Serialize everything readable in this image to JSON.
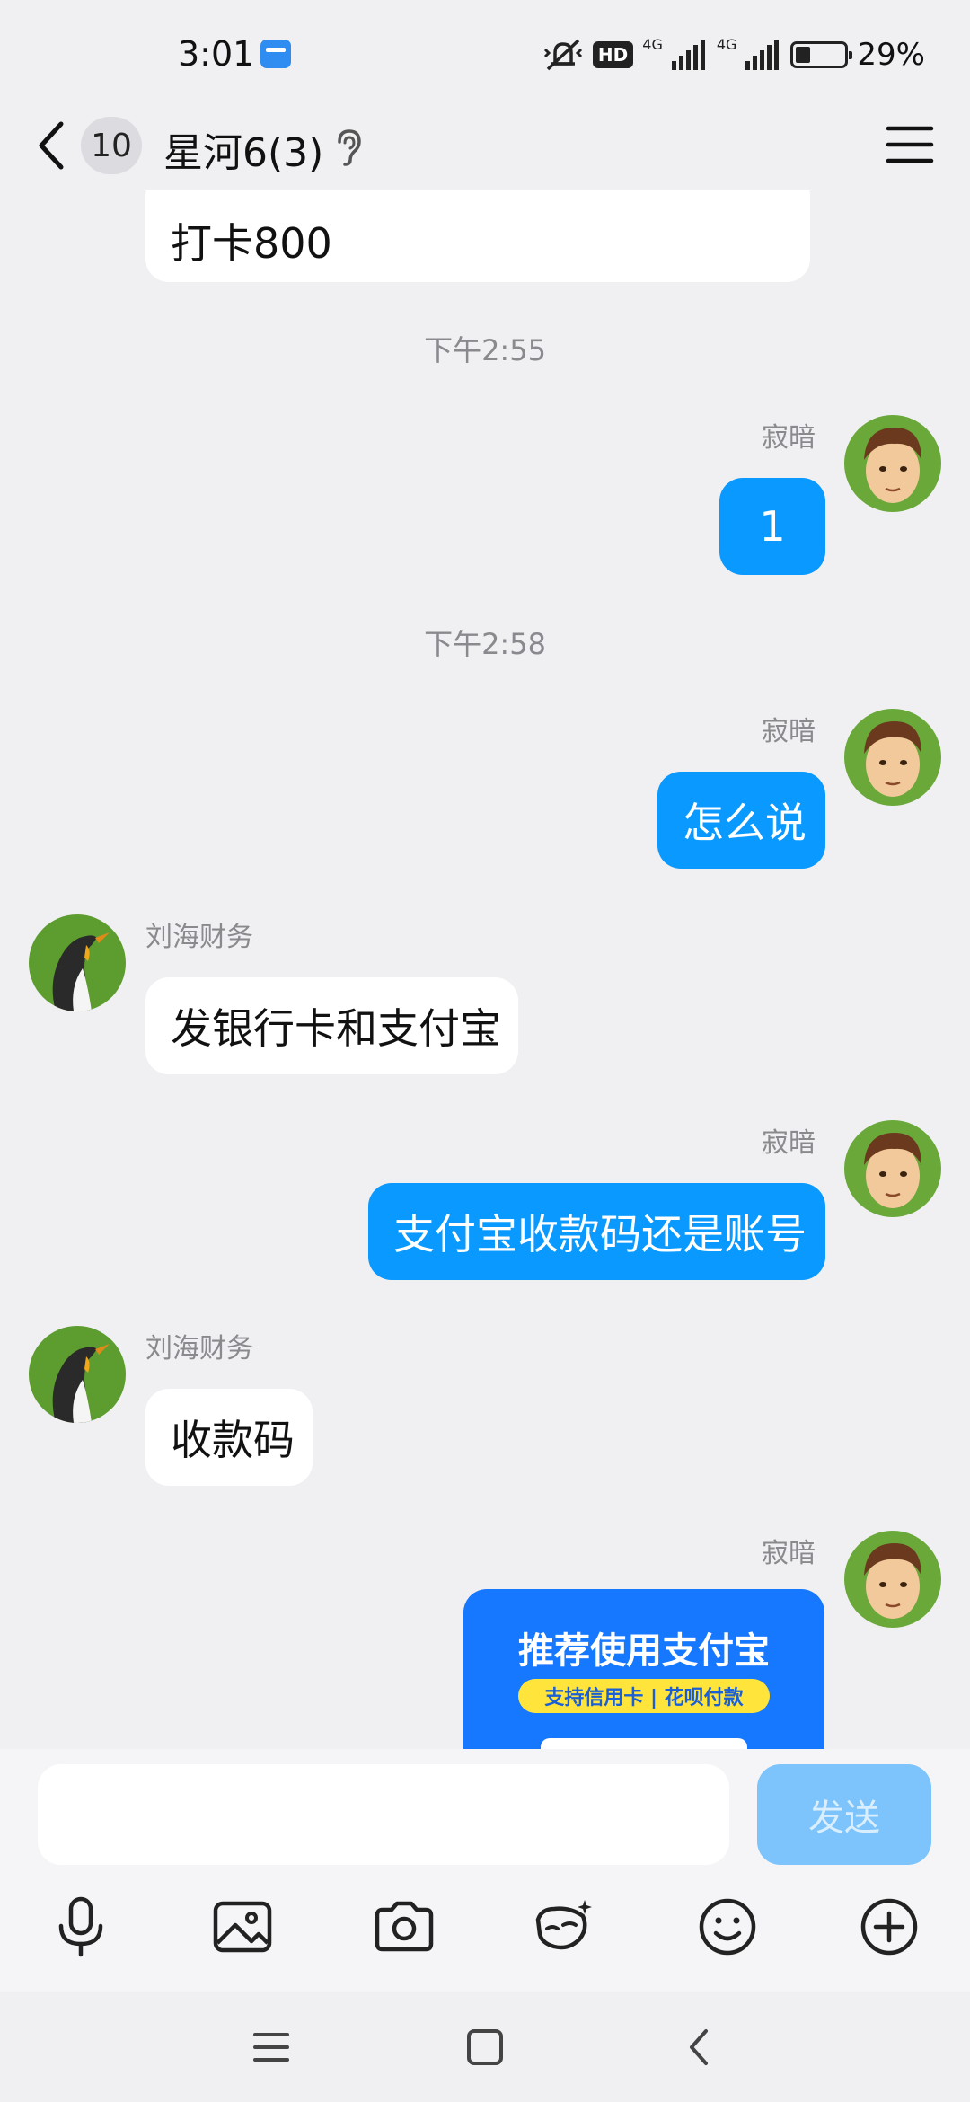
{
  "status_bar": {
    "time": "3:01",
    "network_label": "4G",
    "network_label_2": "4G",
    "hd_label": "HD",
    "battery_text": "29%"
  },
  "header": {
    "unread_count": "10",
    "title": "星河6(3)"
  },
  "messages": {
    "m1": {
      "text": "打卡800"
    },
    "ts1": "下午2:55",
    "m2": {
      "sender": "寂暗",
      "text": "1"
    },
    "ts2": "下午2:58",
    "m3": {
      "sender": "寂暗",
      "text": "怎么说"
    },
    "m4": {
      "sender": "刘海财务",
      "text": "发银行卡和支付宝"
    },
    "m5": {
      "sender": "寂暗",
      "text": "支付宝收款码还是账号"
    },
    "m6": {
      "sender": "刘海财务",
      "text": "收款码"
    },
    "m7": {
      "sender": "寂暗",
      "promo_title": "推荐使用支付宝",
      "promo_subtitle": "支持信用卡 | 花呗付款"
    }
  },
  "composer": {
    "input_value": "",
    "send_label": "发送"
  },
  "toolbar_icons": [
    "microphone-icon",
    "image-icon",
    "camera-icon",
    "ai-sparkle-icon",
    "emoji-icon",
    "plus-icon"
  ],
  "nav_icons": [
    "recents-icon",
    "home-icon",
    "back-icon"
  ],
  "colors": {
    "background": "#f0f0f3",
    "outgoing_bubble": "#0a99ff",
    "incoming_bubble": "#ffffff",
    "send_button": "#7cc4fb",
    "alipay_blue": "#1677ff"
  }
}
